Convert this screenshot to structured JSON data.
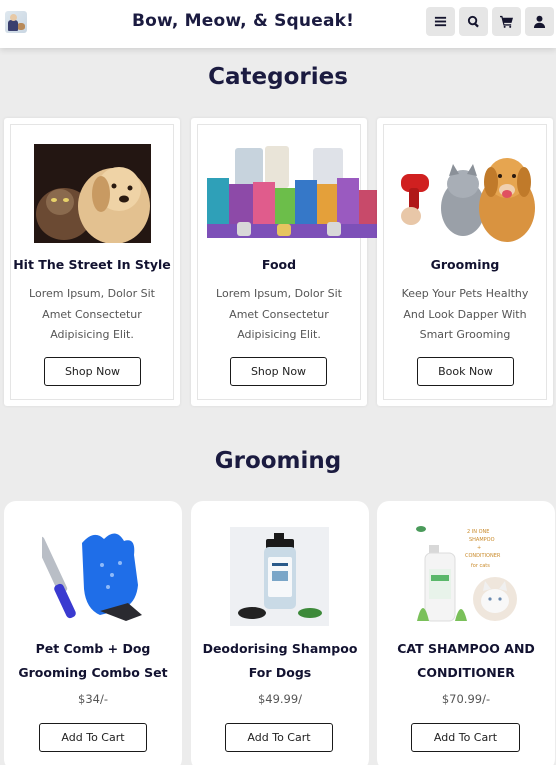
{
  "header": {
    "title": "Bow, Meow, & Squeak!",
    "icons": [
      "menu-icon",
      "search-icon",
      "cart-icon",
      "user-icon"
    ]
  },
  "categories": {
    "title": "Categories",
    "items": [
      {
        "name": "Hit The Street In Style",
        "desc": "Lorem Ipsum, Dolor Sit Amet Consectetur Adipisicing Elit.",
        "button": "Shop Now"
      },
      {
        "name": "Food",
        "desc": "Lorem Ipsum, Dolor Sit Amet Consectetur Adipisicing Elit.",
        "button": "Shop Now"
      },
      {
        "name": "Grooming",
        "desc": "Keep Your Pets Healthy And Look Dapper With Smart Grooming",
        "button": "Book Now"
      }
    ]
  },
  "grooming": {
    "title": "Grooming",
    "products": [
      {
        "name": "Pet Comb + Dog Grooming Combo Set",
        "price": "$34/-",
        "button": "Add To Cart"
      },
      {
        "name": "Deodorising Shampoo For Dogs",
        "price": "$49.99/",
        "button": "Add To Cart"
      },
      {
        "name": "CAT SHAMPOO AND CONDITIONER",
        "price": "$70.99/-",
        "button": "Add To Cart",
        "img_text": "2 IN ONE SHAMPOO + CONDITIONER for cats"
      }
    ]
  }
}
